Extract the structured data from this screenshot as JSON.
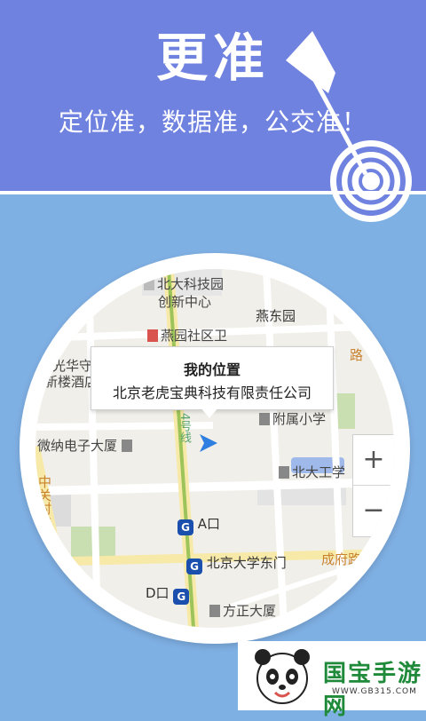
{
  "banner": {
    "headline": "更准",
    "subline": "定位准，数据准，公交准！"
  },
  "map": {
    "labels": {
      "north_sci_park_line1": "北大科技园",
      "north_sci_park_line2": "创新中心",
      "yandong_park": "燕东园",
      "yanyuan_community": "燕园社区卫",
      "road_right_top": "路",
      "guanghua_line1": "一光华守",
      "guanghua_line2": "新楼酒店",
      "affiliated_school": "附属小学",
      "weina_building": "微纳电子大厦",
      "north_univ_engineering": "北大工学",
      "zhongguancun_north": "中关村北路",
      "exit_a": "A口",
      "pku_east_gate": "北京大学东门",
      "chengfu_road": "成府路",
      "exit_d": "D口",
      "fangzheng_building": "方正大厦",
      "subway_line4": "4号线"
    },
    "callout": {
      "title": "我的位置",
      "subtitle": "北京老虎宝典科技有限责任公司"
    },
    "zoom": {
      "in_label": "+",
      "out_label": "−"
    },
    "subway_glyph": "G"
  },
  "watermark": {
    "brand": "国宝手游网",
    "url": "WWW.GB315.COM"
  },
  "colors": {
    "banner": "#6f82e0",
    "background": "#7fb0e4",
    "subway_line": "#9cc45a",
    "location_arrow": "#2f7fe0"
  }
}
